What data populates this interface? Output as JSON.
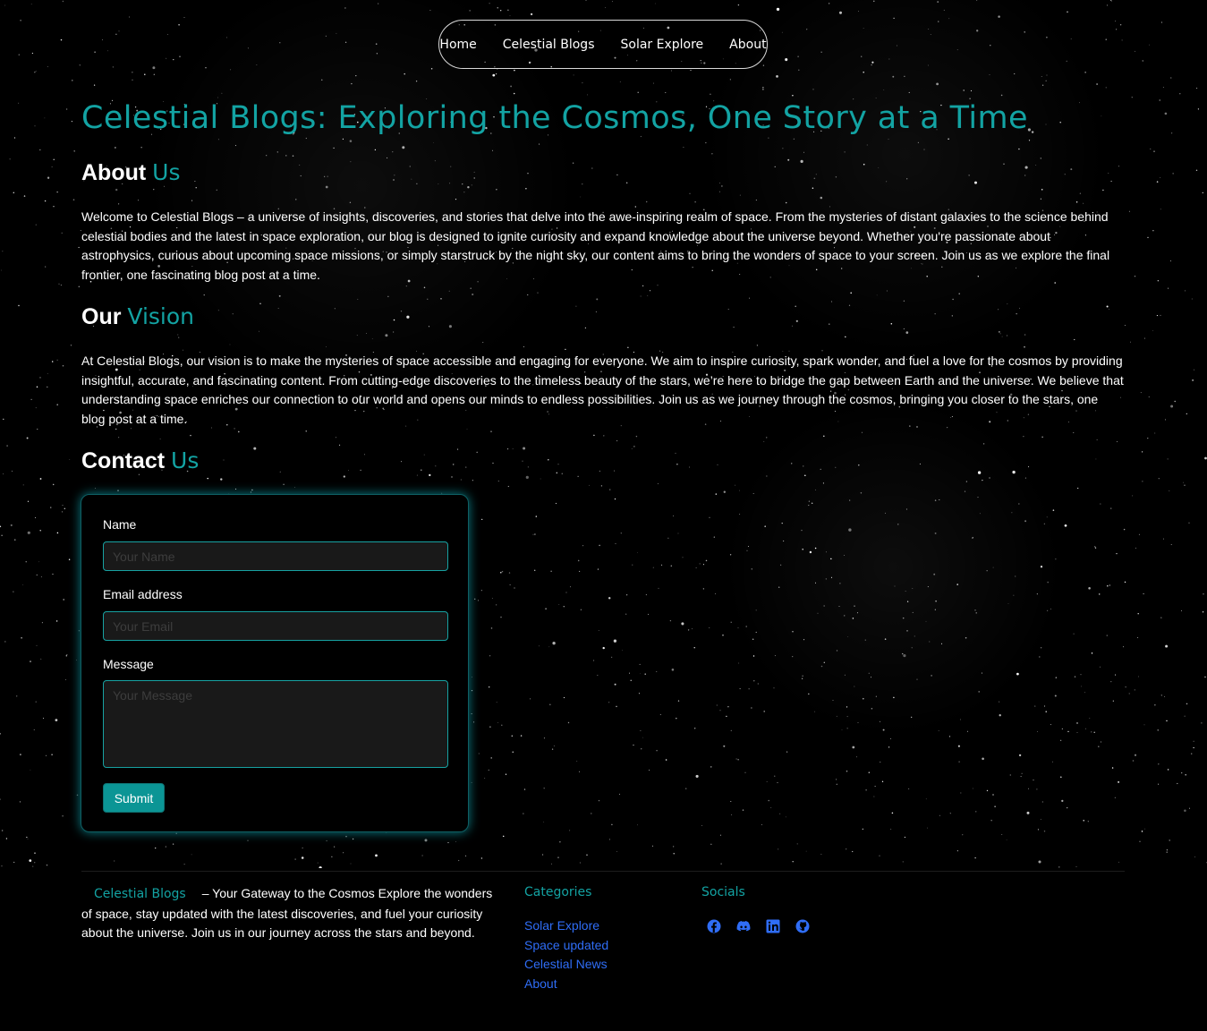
{
  "nav": {
    "items": [
      "Home",
      "Celestial Blogs",
      "Solar Explore",
      "About"
    ]
  },
  "hero": {
    "title": "Celestial Blogs: Exploring the Cosmos, One Story at a Time"
  },
  "about": {
    "heading_main": "About",
    "heading_accent": "Us",
    "text": "Welcome to Celestial Blogs – a universe of insights, discoveries, and stories that delve into the awe-inspiring realm of space. From the mysteries of distant galaxies to the science behind celestial bodies and the latest in space exploration, our blog is designed to ignite curiosity and expand knowledge about the universe beyond. Whether you're passionate about astrophysics, curious about upcoming space missions, or simply starstruck by the night sky, our content aims to bring the wonders of space to your screen. Join us as we explore the final frontier, one fascinating blog post at a time."
  },
  "vision": {
    "heading_main": "Our",
    "heading_accent": "Vision",
    "text": "At Celestial Blogs, our vision is to make the mysteries of space accessible and engaging for everyone. We aim to inspire curiosity, spark wonder, and fuel a love for the cosmos by providing insightful, accurate, and fascinating content. From cutting-edge discoveries to the timeless beauty of the stars, we’re here to bridge the gap between Earth and the universe. We believe that understanding space enriches our connection to our world and opens our minds to endless possibilities. Join us as we journey through the cosmos, bringing you closer to the stars, one blog post at a time."
  },
  "contact": {
    "heading_main": "Contact",
    "heading_accent": "Us",
    "name_label": "Name",
    "name_placeholder": "Your Name",
    "email_label": "Email address",
    "email_placeholder": "Your Email",
    "message_label": "Message",
    "message_placeholder": "Your Message",
    "submit_label": "Submit"
  },
  "footer": {
    "brand": "Celestial Blogs",
    "tagline": "– Your Gateway to the Cosmos Explore the wonders of space, stay updated with the latest discoveries, and fuel your curiosity about the universe. Join us in our journey across the stars and beyond.",
    "categories_heading": "Categories",
    "categories": [
      "Solar Explore",
      "Space updated",
      "Celestial News",
      "About"
    ],
    "socials_heading": "Socials",
    "social_icons": [
      "facebook-icon",
      "discord-icon",
      "linkedin-icon",
      "github-icon"
    ]
  },
  "colors": {
    "accent": "#13a3a3",
    "link": "#2f6df6",
    "background": "#000000"
  }
}
